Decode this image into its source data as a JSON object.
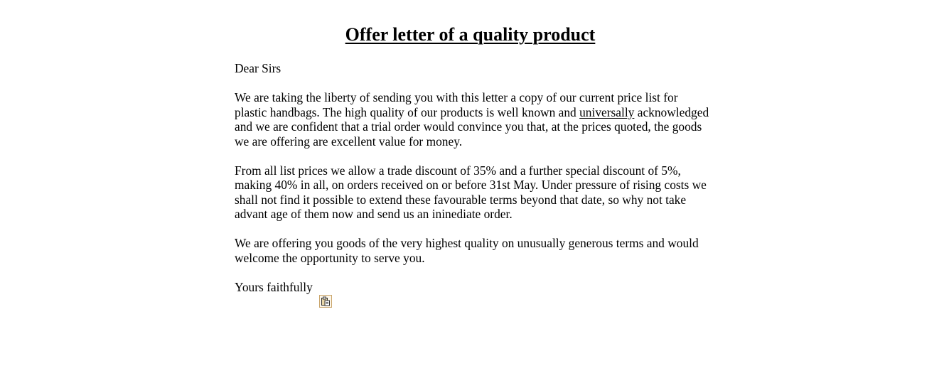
{
  "title": "Offer letter of a quality product",
  "letter": {
    "salutation": "Dear Sirs",
    "paragraph1": {
      "before": "We are taking the liberty of sending you with this letter a copy of our current price list for plastic handbags. The high quality of our products is well known and ",
      "underlined": "universally",
      "after": " acknowledged and we are confident that a trial order would convince you that, at the prices quoted, the goods we are offering are excellent value for money."
    },
    "paragraph2": "From all list prices we allow a trade discount of 35% and a further special discount of 5%, making 40% in all, on orders received on or before 31st May. Under pressure of rising costs we shall not find it possible to extend these favourable terms beyond that date, so why not take advant age of them now and send us an ininediate order.",
    "paragraph3": "We are offering you goods of the very highest quality on unusually generous terms and would welcome the opportunity to serve you.",
    "closing": "Yours faithfully"
  },
  "icons": {
    "paste_options": "paste-options-icon"
  }
}
